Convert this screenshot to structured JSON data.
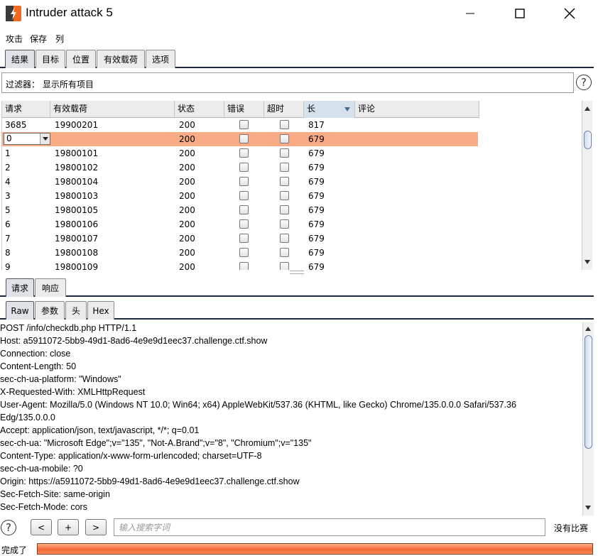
{
  "window": {
    "title": "Intruder attack 5",
    "accent": "#f58f5c"
  },
  "menu": [
    "攻击",
    "保存",
    "列"
  ],
  "top_tabs": [
    {
      "label": "结果",
      "active": true
    },
    {
      "label": "目标",
      "active": false
    },
    {
      "label": "位置",
      "active": false
    },
    {
      "label": "有效载荷",
      "active": false
    },
    {
      "label": "选项",
      "active": false
    }
  ],
  "filter": {
    "text": "过滤器： 显示所有项目"
  },
  "table": {
    "columns": [
      "请求",
      "有效载荷",
      "状态",
      "错误",
      "超时",
      "长",
      "评论"
    ],
    "sorted_column": "长",
    "rows": [
      {
        "request": "3685",
        "payload": "19900201",
        "status": "200",
        "length": "817",
        "selected": false
      },
      {
        "request": "0",
        "payload": "",
        "status": "200",
        "length": "679",
        "selected": true
      },
      {
        "request": "1",
        "payload": "19800101",
        "status": "200",
        "length": "679",
        "selected": false
      },
      {
        "request": "2",
        "payload": "19800102",
        "status": "200",
        "length": "679",
        "selected": false
      },
      {
        "request": "4",
        "payload": "19800104",
        "status": "200",
        "length": "679",
        "selected": false
      },
      {
        "request": "3",
        "payload": "19800103",
        "status": "200",
        "length": "679",
        "selected": false
      },
      {
        "request": "5",
        "payload": "19800105",
        "status": "200",
        "length": "679",
        "selected": false
      },
      {
        "request": "6",
        "payload": "19800106",
        "status": "200",
        "length": "679",
        "selected": false
      },
      {
        "request": "7",
        "payload": "19800107",
        "status": "200",
        "length": "679",
        "selected": false
      },
      {
        "request": "8",
        "payload": "19800108",
        "status": "200",
        "length": "679",
        "selected": false
      },
      {
        "request": "9",
        "payload": "19800109",
        "status": "200",
        "length": "679",
        "selected": false
      }
    ]
  },
  "mid_tabs": [
    {
      "label": "请求",
      "active": true
    },
    {
      "label": "响应",
      "active": false
    }
  ],
  "format_tabs": [
    {
      "label": "Raw",
      "active": true
    },
    {
      "label": "参数",
      "active": false
    },
    {
      "label": "头",
      "active": false
    },
    {
      "label": "Hex",
      "active": false
    }
  ],
  "request_lines": [
    "POST /info/checkdb.php HTTP/1.1",
    "Host: a5911072-5bb9-49d1-8ad6-4e9e9d1eec37.challenge.ctf.show",
    "Connection: close",
    "Content-Length: 50",
    "sec-ch-ua-platform: \"Windows\"",
    "X-Requested-With: XMLHttpRequest",
    "User-Agent: Mozilla/5.0 (Windows NT 10.0; Win64; x64) AppleWebKit/537.36 (KHTML, like Gecko) Chrome/135.0.0.0 Safari/537.36",
    "Edg/135.0.0.0",
    "Accept: application/json, text/javascript, */*; q=0.01",
    "sec-ch-ua: \"Microsoft Edge\";v=\"135\", \"Not-A.Brand\";v=\"8\", \"Chromium\";v=\"135\"",
    "Content-Type: application/x-www-form-urlencoded; charset=UTF-8",
    "sec-ch-ua-mobile: ?0",
    "Origin: https://a5911072-5bb9-49d1-8ad6-4e9e9d1eec37.challenge.ctf.show",
    "Sec-Fetch-Site: same-origin",
    "Sec-Fetch-Mode: cors"
  ],
  "search": {
    "prev_label": "<",
    "add_label": "+",
    "next_label": ">",
    "placeholder": "输入搜索字词",
    "match_text": "没有比赛"
  },
  "status": {
    "text": "完成了",
    "progress": 1.0
  }
}
